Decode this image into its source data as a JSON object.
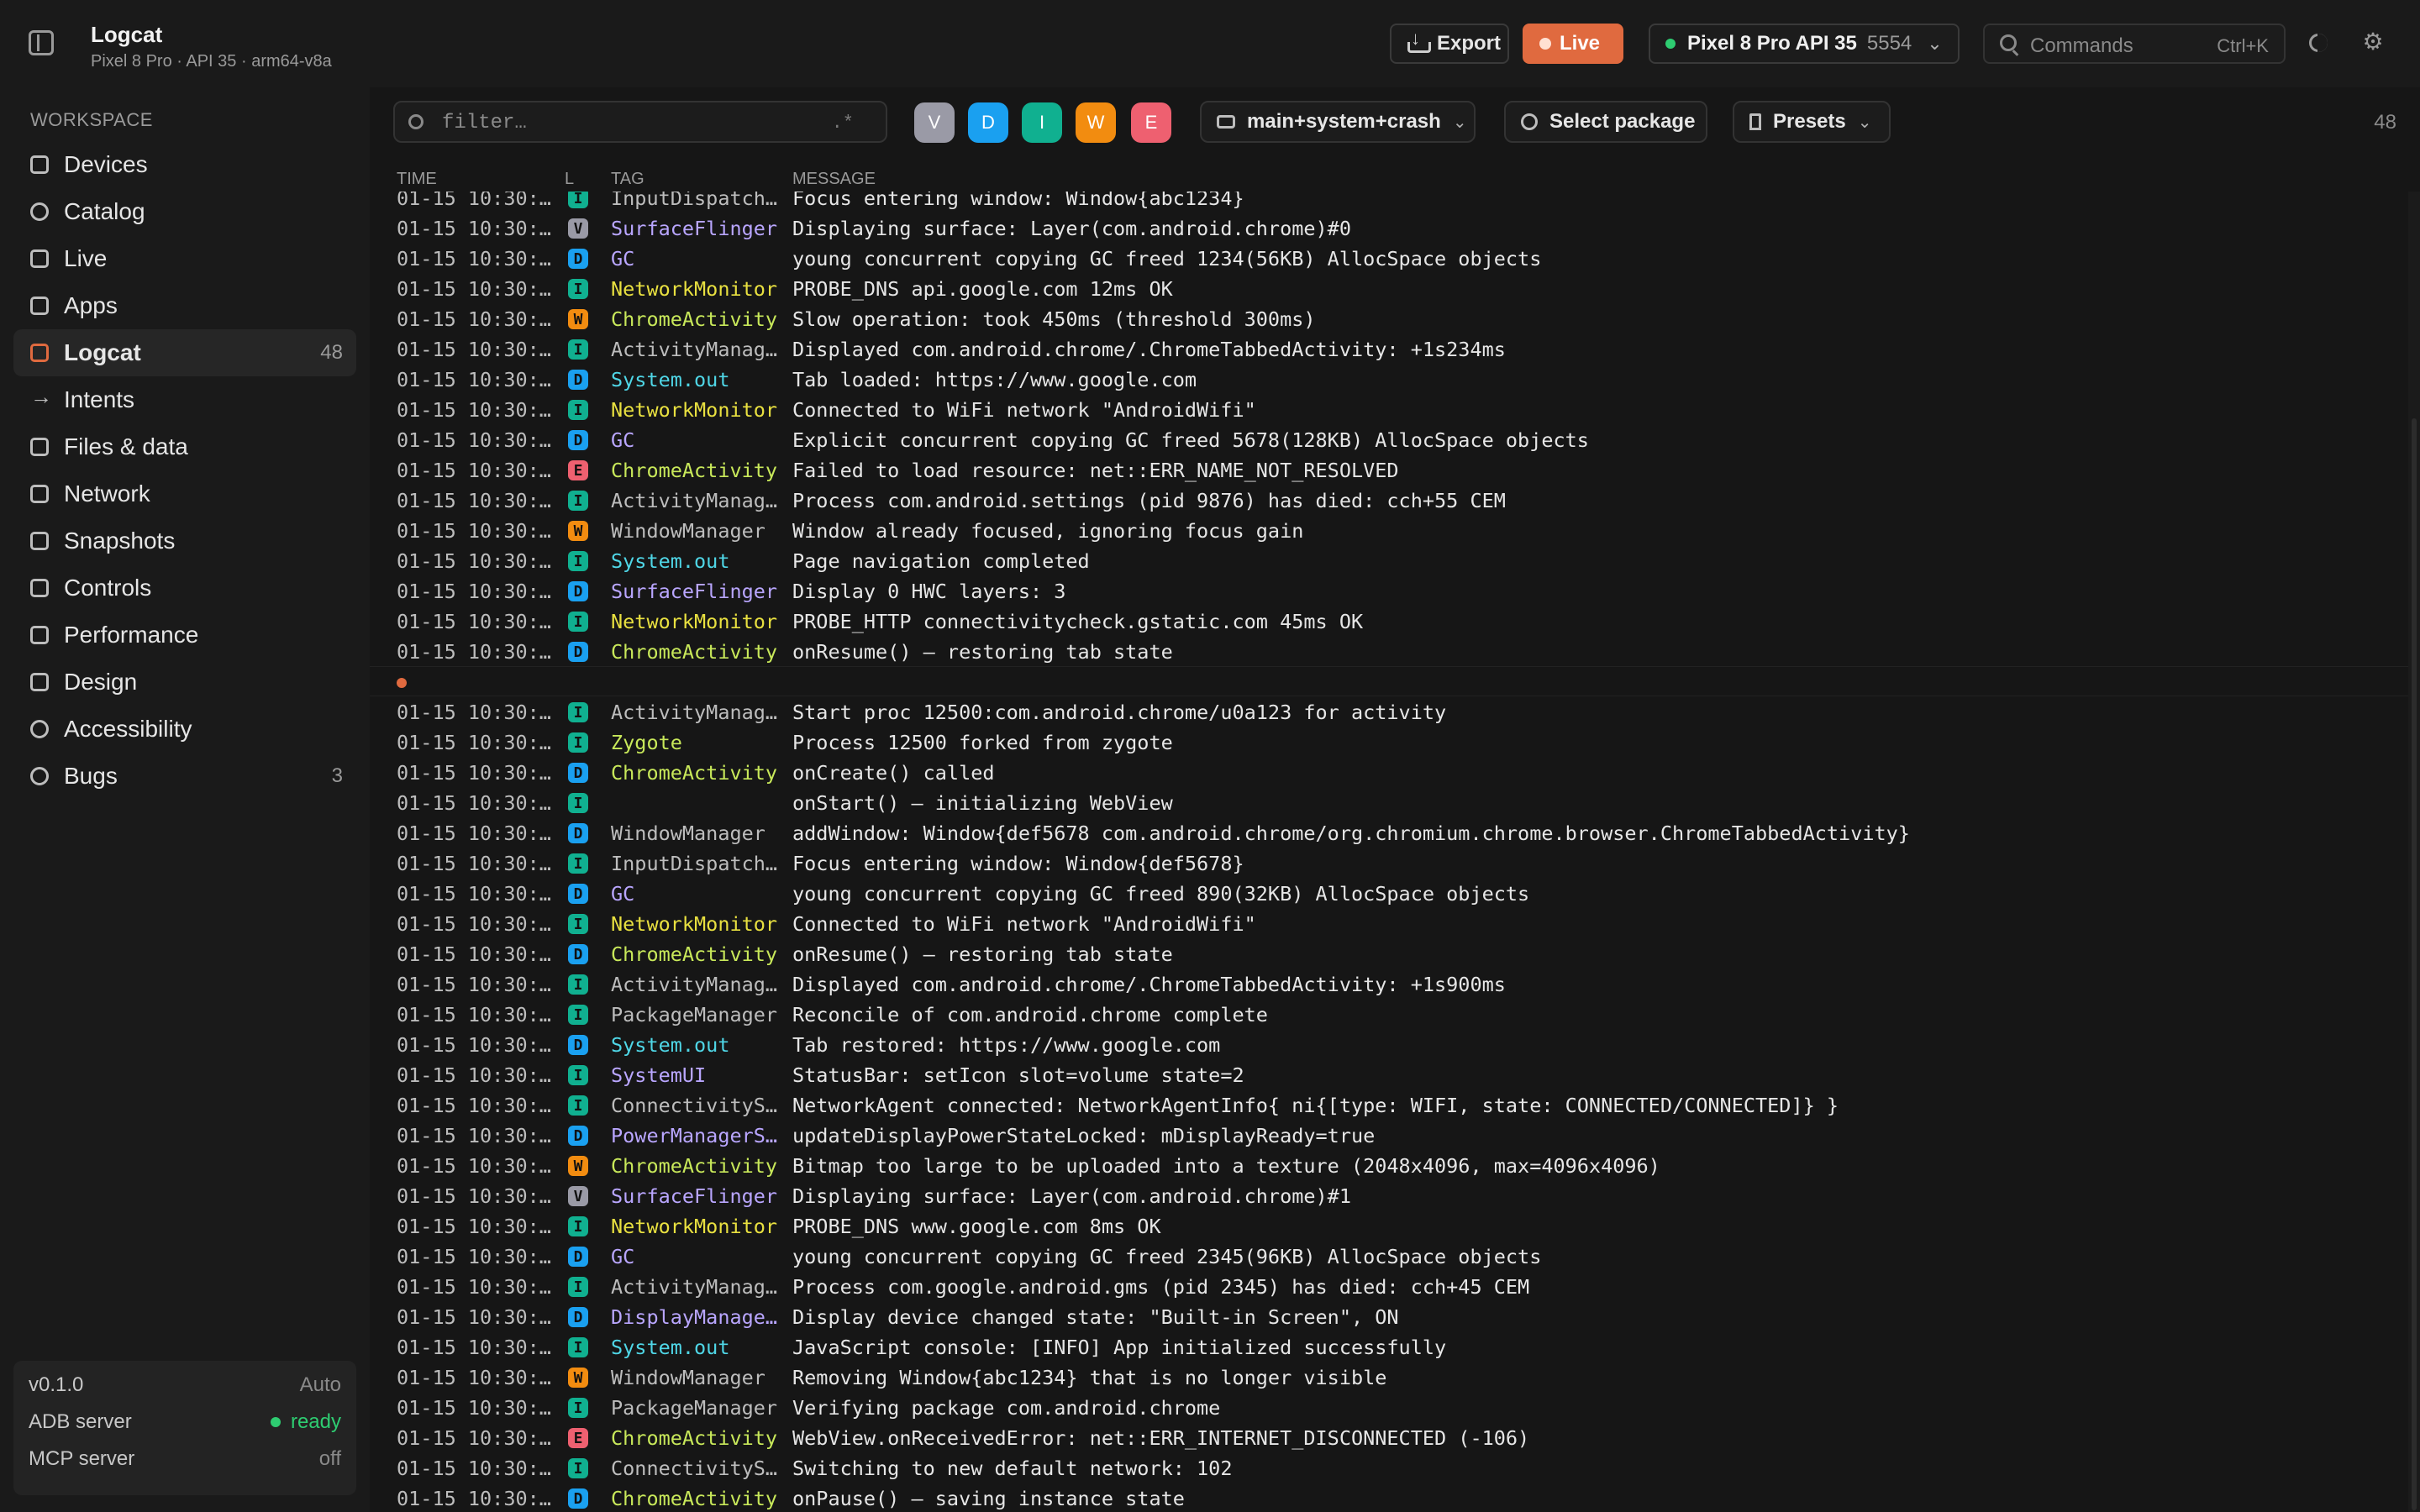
{
  "header": {
    "title": "Logcat",
    "subtitle": "Pixel 8 Pro · API 35 · arm64-v8a",
    "export_label": "Export",
    "live_label": "Live",
    "device_name": "Pixel 8 Pro API 35",
    "device_port": "5554",
    "commands_placeholder": "Commands",
    "commands_shortcut": "Ctrl+K"
  },
  "sidebar": {
    "section_label": "WORKSPACE",
    "items": [
      {
        "label": "Devices",
        "icon": "devices-icon",
        "count": ""
      },
      {
        "label": "Catalog",
        "icon": "catalog-icon",
        "count": ""
      },
      {
        "label": "Live",
        "icon": "live-icon",
        "count": ""
      },
      {
        "label": "Apps",
        "icon": "apps-icon",
        "count": ""
      },
      {
        "label": "Logcat",
        "icon": "logcat-icon",
        "count": "48"
      },
      {
        "label": "Intents",
        "icon": "arrow-right-icon",
        "count": ""
      },
      {
        "label": "Files & data",
        "icon": "folder-icon",
        "count": ""
      },
      {
        "label": "Network",
        "icon": "network-icon",
        "count": ""
      },
      {
        "label": "Snapshots",
        "icon": "snapshots-icon",
        "count": ""
      },
      {
        "label": "Controls",
        "icon": "controls-icon",
        "count": ""
      },
      {
        "label": "Performance",
        "icon": "performance-icon",
        "count": ""
      },
      {
        "label": "Design",
        "icon": "design-icon",
        "count": ""
      },
      {
        "label": "Accessibility",
        "icon": "accessibility-icon",
        "count": ""
      },
      {
        "label": "Bugs",
        "icon": "bug-icon",
        "count": "3"
      }
    ],
    "version": "v0.1.0",
    "version_mode": "Auto",
    "adb_label": "ADB server",
    "adb_status": "ready",
    "mcp_label": "MCP server",
    "mcp_status": "off"
  },
  "toolbar": {
    "filter_placeholder": "filter…",
    "regex_label": ".*",
    "levels": [
      {
        "label": "V",
        "color": "#9a9aa6"
      },
      {
        "label": "D",
        "color": "#1aa0f0"
      },
      {
        "label": "I",
        "color": "#10b090"
      },
      {
        "label": "W",
        "color": "#f28c10"
      },
      {
        "label": "E",
        "color": "#ee6070"
      }
    ],
    "buffers_label": "main+system+crash",
    "select_package_label": "Select package",
    "presets_label": "Presets",
    "row_count": "48"
  },
  "columns": {
    "time": "TIME",
    "level": "L",
    "tag": "TAG",
    "message": "MESSAGE"
  },
  "colors": {
    "accent": "#e06a3f",
    "level_V": "#9a9aa6",
    "level_D": "#1aa0f0",
    "level_I": "#10b090",
    "level_W": "#f28c10",
    "level_E": "#ee6070",
    "tag_purple": "#b9a6ff",
    "tag_cyan": "#4fd6e6",
    "tag_yellow": "#e8e040",
    "tag_lime": "#c8e85a",
    "tag_grey": "#bdbdbd"
  },
  "logs": [
    {
      "time": "01-15 10:30:…",
      "level": "I",
      "tag": "InputDispatch…",
      "tag_color": "#bdbdbd",
      "message": "Focus entering window: Window{abc1234}"
    },
    {
      "time": "01-15 10:30:…",
      "level": "V",
      "tag": "SurfaceFlinger",
      "tag_color": "#b9a6ff",
      "message": "Displaying surface: Layer(com.android.chrome)#0"
    },
    {
      "time": "01-15 10:30:…",
      "level": "D",
      "tag": "GC",
      "tag_color": "#b9a6ff",
      "message": "young concurrent copying GC freed 1234(56KB) AllocSpace objects"
    },
    {
      "time": "01-15 10:30:…",
      "level": "I",
      "tag": "NetworkMonitor",
      "tag_color": "#e8e040",
      "message": "PROBE_DNS api.google.com 12ms OK"
    },
    {
      "time": "01-15 10:30:…",
      "level": "W",
      "tag": "ChromeActivity",
      "tag_color": "#c8e85a",
      "message": "Slow operation: took 450ms (threshold 300ms)"
    },
    {
      "time": "01-15 10:30:…",
      "level": "I",
      "tag": "ActivityManag…",
      "tag_color": "#bdbdbd",
      "message": "Displayed com.android.chrome/.ChromeTabbedActivity: +1s234ms"
    },
    {
      "time": "01-15 10:30:…",
      "level": "D",
      "tag": "System.out",
      "tag_color": "#4fd6e6",
      "message": "Tab loaded: https://www.google.com"
    },
    {
      "time": "01-15 10:30:…",
      "level": "I",
      "tag": "NetworkMonitor",
      "tag_color": "#e8e040",
      "message": "Connected to WiFi network \"AndroidWifi\""
    },
    {
      "time": "01-15 10:30:…",
      "level": "D",
      "tag": "GC",
      "tag_color": "#b9a6ff",
      "message": "Explicit concurrent copying GC freed 5678(128KB) AllocSpace objects"
    },
    {
      "time": "01-15 10:30:…",
      "level": "E",
      "tag": "ChromeActivity",
      "tag_color": "#c8e85a",
      "message": "Failed to load resource: net::ERR_NAME_NOT_RESOLVED"
    },
    {
      "time": "01-15 10:30:…",
      "level": "I",
      "tag": "ActivityManag…",
      "tag_color": "#bdbdbd",
      "message": "Process com.android.settings (pid 9876) has died: cch+55 CEM"
    },
    {
      "time": "01-15 10:30:…",
      "level": "W",
      "tag": "WindowManager",
      "tag_color": "#bdbdbd",
      "message": "Window already focused, ignoring focus gain"
    },
    {
      "time": "01-15 10:30:…",
      "level": "I",
      "tag": "System.out",
      "tag_color": "#4fd6e6",
      "message": "Page navigation completed"
    },
    {
      "time": "01-15 10:30:…",
      "level": "D",
      "tag": "SurfaceFlinger",
      "tag_color": "#b9a6ff",
      "message": "Display 0 HWC layers: 3"
    },
    {
      "time": "01-15 10:30:…",
      "level": "I",
      "tag": "NetworkMonitor",
      "tag_color": "#e8e040",
      "message": "PROBE_HTTP connectivitycheck.gstatic.com 45ms OK"
    },
    {
      "time": "01-15 10:30:…",
      "level": "D",
      "tag": "ChromeActivity",
      "tag_color": "#c8e85a",
      "message": "onResume() — restoring tab state"
    },
    {
      "marker": true
    },
    {
      "time": "01-15 10:30:…",
      "level": "I",
      "tag": "ActivityManag…",
      "tag_color": "#bdbdbd",
      "message": "Start proc 12500:com.android.chrome/u0a123 for activity"
    },
    {
      "time": "01-15 10:30:…",
      "level": "I",
      "tag": "Zygote",
      "tag_color": "#c8e85a",
      "message": "Process 12500 forked from zygote"
    },
    {
      "time": "01-15 10:30:…",
      "level": "D",
      "tag": "ChromeActivity",
      "tag_color": "#c8e85a",
      "message": "onCreate() called"
    },
    {
      "time": "01-15 10:30:…",
      "level": "I",
      "tag": "",
      "tag_color": "#bdbdbd",
      "message": "onStart() — initializing WebView"
    },
    {
      "time": "01-15 10:30:…",
      "level": "D",
      "tag": "WindowManager",
      "tag_color": "#bdbdbd",
      "message": "addWindow: Window{def5678 com.android.chrome/org.chromium.chrome.browser.ChromeTabbedActivity}"
    },
    {
      "time": "01-15 10:30:…",
      "level": "I",
      "tag": "InputDispatch…",
      "tag_color": "#bdbdbd",
      "message": "Focus entering window: Window{def5678}"
    },
    {
      "time": "01-15 10:30:…",
      "level": "D",
      "tag": "GC",
      "tag_color": "#b9a6ff",
      "message": "young concurrent copying GC freed 890(32KB) AllocSpace objects"
    },
    {
      "time": "01-15 10:30:…",
      "level": "I",
      "tag": "NetworkMonitor",
      "tag_color": "#e8e040",
      "message": "Connected to WiFi network \"AndroidWifi\""
    },
    {
      "time": "01-15 10:30:…",
      "level": "D",
      "tag": "ChromeActivity",
      "tag_color": "#c8e85a",
      "message": "onResume() — restoring tab state"
    },
    {
      "time": "01-15 10:30:…",
      "level": "I",
      "tag": "ActivityManag…",
      "tag_color": "#bdbdbd",
      "message": "Displayed com.android.chrome/.ChromeTabbedActivity: +1s900ms"
    },
    {
      "time": "01-15 10:30:…",
      "level": "I",
      "tag": "PackageManager",
      "tag_color": "#bdbdbd",
      "message": "Reconcile of com.android.chrome complete"
    },
    {
      "time": "01-15 10:30:…",
      "level": "D",
      "tag": "System.out",
      "tag_color": "#4fd6e6",
      "message": "Tab restored: https://www.google.com"
    },
    {
      "time": "01-15 10:30:…",
      "level": "I",
      "tag": "SystemUI",
      "tag_color": "#b9a6ff",
      "message": "StatusBar: setIcon slot=volume state=2"
    },
    {
      "time": "01-15 10:30:…",
      "level": "I",
      "tag": "ConnectivityS…",
      "tag_color": "#bdbdbd",
      "message": "NetworkAgent connected: NetworkAgentInfo{ ni{[type: WIFI, state: CONNECTED/CONNECTED]} }"
    },
    {
      "time": "01-15 10:30:…",
      "level": "D",
      "tag": "PowerManagerS…",
      "tag_color": "#b9a6ff",
      "message": "updateDisplayPowerStateLocked: mDisplayReady=true"
    },
    {
      "time": "01-15 10:30:…",
      "level": "W",
      "tag": "ChromeActivity",
      "tag_color": "#c8e85a",
      "message": "Bitmap too large to be uploaded into a texture (2048x4096, max=4096x4096)"
    },
    {
      "time": "01-15 10:30:…",
      "level": "V",
      "tag": "SurfaceFlinger",
      "tag_color": "#b9a6ff",
      "message": "Displaying surface: Layer(com.android.chrome)#1"
    },
    {
      "time": "01-15 10:30:…",
      "level": "I",
      "tag": "NetworkMonitor",
      "tag_color": "#e8e040",
      "message": "PROBE_DNS www.google.com 8ms OK"
    },
    {
      "time": "01-15 10:30:…",
      "level": "D",
      "tag": "GC",
      "tag_color": "#b9a6ff",
      "message": "young concurrent copying GC freed 2345(96KB) AllocSpace objects"
    },
    {
      "time": "01-15 10:30:…",
      "level": "I",
      "tag": "ActivityManag…",
      "tag_color": "#bdbdbd",
      "message": "Process com.google.android.gms (pid 2345) has died: cch+45 CEM"
    },
    {
      "time": "01-15 10:30:…",
      "level": "D",
      "tag": "DisplayManage…",
      "tag_color": "#b9a6ff",
      "message": "Display device changed state: \"Built-in Screen\", ON"
    },
    {
      "time": "01-15 10:30:…",
      "level": "I",
      "tag": "System.out",
      "tag_color": "#4fd6e6",
      "message": "JavaScript console: [INFO] App initialized successfully"
    },
    {
      "time": "01-15 10:30:…",
      "level": "W",
      "tag": "WindowManager",
      "tag_color": "#bdbdbd",
      "message": "Removing Window{abc1234} that is no longer visible"
    },
    {
      "time": "01-15 10:30:…",
      "level": "I",
      "tag": "PackageManager",
      "tag_color": "#bdbdbd",
      "message": "Verifying package com.android.chrome"
    },
    {
      "time": "01-15 10:30:…",
      "level": "E",
      "tag": "ChromeActivity",
      "tag_color": "#c8e85a",
      "message": "WebView.onReceivedError: net::ERR_INTERNET_DISCONNECTED (-106)"
    },
    {
      "time": "01-15 10:30:…",
      "level": "I",
      "tag": "ConnectivityS…",
      "tag_color": "#bdbdbd",
      "message": "Switching to new default network: 102"
    },
    {
      "time": "01-15 10:30:…",
      "level": "D",
      "tag": "ChromeActivity",
      "tag_color": "#c8e85a",
      "message": "onPause() — saving instance state"
    }
  ]
}
